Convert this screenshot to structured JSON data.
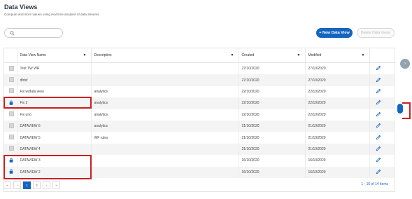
{
  "page": {
    "title": "Data Views",
    "subtitle": "Compute and store values using real time analysis of data streams"
  },
  "search": {
    "placeholder": ""
  },
  "toolbar": {
    "new_label": "+ New Data View",
    "delete_label": "Delete Data Views"
  },
  "table": {
    "columns": [
      "Data View Name",
      "Description",
      "Created",
      "Modified"
    ],
    "rows": [
      {
        "locked": false,
        "name": "Test TW WR",
        "description": "",
        "created": "27/10/2020",
        "modified": "27/10/2020"
      },
      {
        "locked": false,
        "name": "dfdsf",
        "description": "",
        "created": "27/10/2020",
        "modified": "27/10/2020"
      },
      {
        "locked": false,
        "name": "Fix w/data view",
        "description": "analytics",
        "created": "22/10/2020",
        "modified": "22/10/2020"
      },
      {
        "locked": true,
        "name": "Fix 2",
        "description": "analytics",
        "created": "22/10/2020",
        "modified": "22/10/2020"
      },
      {
        "locked": false,
        "name": "Fix uno",
        "description": "analytics",
        "created": "22/10/2020",
        "modified": "22/10/2020"
      },
      {
        "locked": false,
        "name": "DATAVIEW 6",
        "description": "analytics",
        "created": "21/10/2020",
        "modified": "21/10/2020"
      },
      {
        "locked": false,
        "name": "DATAVIEW 5",
        "description": "WF rules",
        "created": "21/10/2020",
        "modified": "21/10/2020"
      },
      {
        "locked": false,
        "name": "DATAVIEW 4",
        "description": "",
        "created": "21/10/2020",
        "modified": "21/10/2020"
      },
      {
        "locked": true,
        "name": "DATAVIEW 3",
        "description": "",
        "created": "16/10/2020",
        "modified": "16/10/2020"
      },
      {
        "locked": true,
        "name": "DATAVIEW 2",
        "description": "",
        "created": "16/10/2020",
        "modified": "16/10/2020"
      }
    ]
  },
  "pagination": {
    "first": "«",
    "prev": "‹",
    "pages": [
      "1",
      "2"
    ],
    "current": "1",
    "next": "›",
    "last": "»",
    "summary": "1 - 10 of 14 items"
  },
  "side": {
    "arrow": "›"
  },
  "colors": {
    "accent": "#1565c0",
    "highlight": "#cc1f1f",
    "lock": "#1565c0"
  }
}
